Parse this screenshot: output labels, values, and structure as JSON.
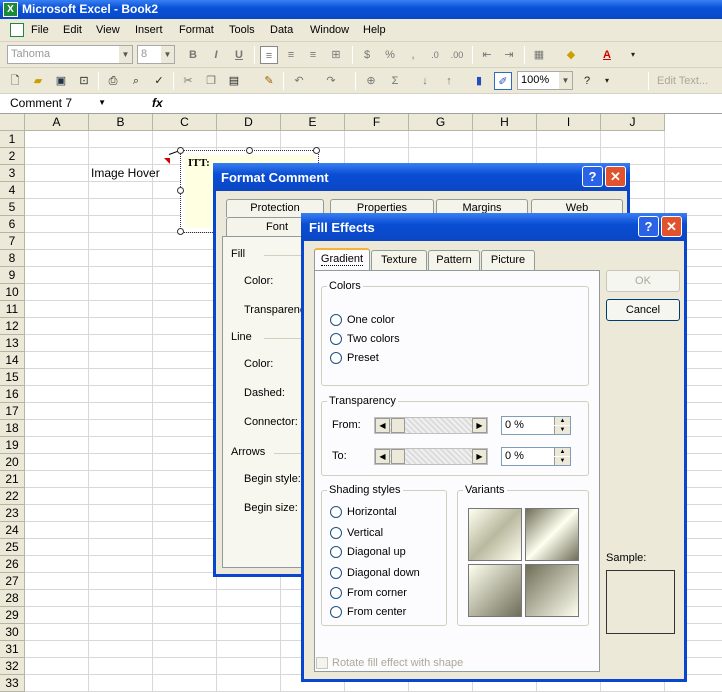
{
  "window": {
    "title": "Microsoft Excel - Book2"
  },
  "menu": [
    "File",
    "Edit",
    "View",
    "Insert",
    "Format",
    "Tools",
    "Data",
    "Window",
    "Help"
  ],
  "toolbar": {
    "font_name": "Tahoma",
    "font_size": "8",
    "zoom": "100%",
    "edit_text": "Edit Text..."
  },
  "formula_bar": {
    "name_box": "Comment 7",
    "fx": "fx"
  },
  "sheet": {
    "columns": [
      "A",
      "B",
      "C",
      "D",
      "E",
      "F",
      "G",
      "H",
      "I",
      "J"
    ],
    "rows": [
      "1",
      "2",
      "3",
      "4",
      "5",
      "6",
      "7",
      "8",
      "9",
      "10",
      "11",
      "12",
      "13",
      "14",
      "15",
      "16",
      "17",
      "18",
      "19",
      "20",
      "21",
      "22",
      "23",
      "24",
      "25",
      "26",
      "27",
      "28",
      "29",
      "30",
      "31",
      "32",
      "33"
    ],
    "cell_b3": "Image Hover",
    "comment_text": "ITT:"
  },
  "format_comment": {
    "title": "Format Comment",
    "tabs_row1": [
      "Protection",
      "Properties",
      "Margins",
      "Web"
    ],
    "tabs_row2": [
      "Font"
    ],
    "sections": {
      "fill": "Fill",
      "line": "Line",
      "arrows": "Arrows"
    },
    "labels": {
      "fill_color": "Color:",
      "transparency": "Transparency",
      "line_color": "Color:",
      "dashed": "Dashed:",
      "connector": "Connector:",
      "begin_style": "Begin style:",
      "begin_size": "Begin size:"
    }
  },
  "fill_effects": {
    "title": "Fill Effects",
    "tabs": [
      "Gradient",
      "Texture",
      "Pattern",
      "Picture"
    ],
    "buttons": {
      "ok": "OK",
      "cancel": "Cancel"
    },
    "colors": {
      "label": "Colors",
      "options": [
        "One color",
        "Two colors",
        "Preset"
      ]
    },
    "transparency": {
      "label": "Transparency",
      "from_label": "From:",
      "to_label": "To:",
      "from_value": "0 %",
      "to_value": "0 %"
    },
    "shading": {
      "label": "Shading styles",
      "options": [
        "Horizontal",
        "Vertical",
        "Diagonal up",
        "Diagonal down",
        "From corner",
        "From center"
      ]
    },
    "variants_label": "Variants",
    "sample_label": "Sample:",
    "rotate_label": "Rotate fill effect with shape"
  }
}
